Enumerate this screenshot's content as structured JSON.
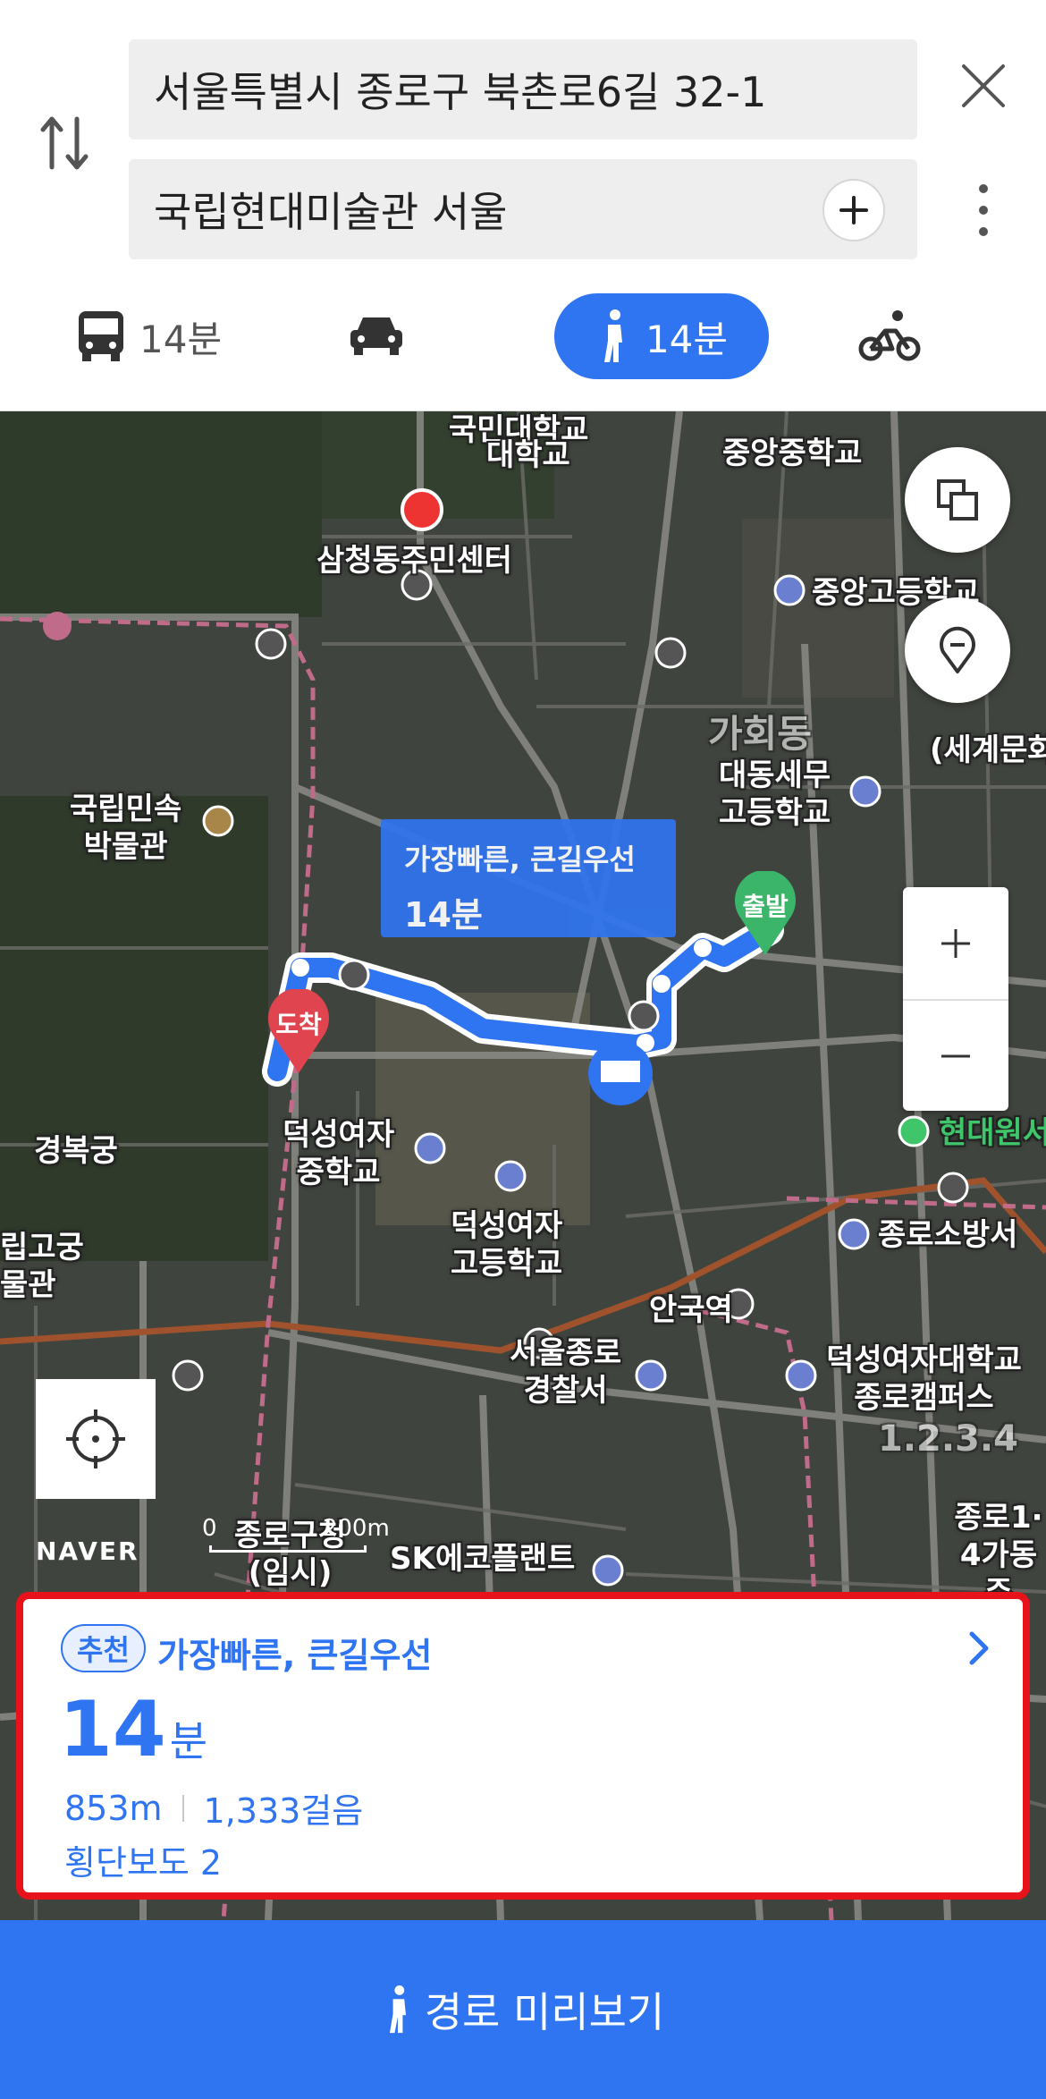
{
  "search": {
    "origin": "서울특별시 종로구 북촌로6길 32-1",
    "destination": "국립현대미술관 서울"
  },
  "modes": [
    {
      "name": "transit",
      "label": "14분"
    },
    {
      "name": "car",
      "label": ""
    },
    {
      "name": "walk",
      "label": "14분",
      "selected": true
    },
    {
      "name": "bike",
      "label": ""
    }
  ],
  "map": {
    "labels": {
      "univ": "대학교",
      "univ_top": "국민대학교",
      "jungang_middle": "중앙중학교",
      "samcheong": "삼청동주민센터",
      "jungang_high": "중앙고등학교",
      "daedong": "대동세무\n고등학교",
      "sekye": "(세계문화",
      "gahoe": "가회동",
      "folk_museum": "국립민속\n박물관",
      "gyeongbok": "경복궁",
      "duksung_middle": "덕성여자\n중학교",
      "duksung_high": "덕성여자\n고등학교",
      "hyundai": "현대원서",
      "fire_station": "종로소방서",
      "anguk": "안국역",
      "police": "서울종로\n경찰서",
      "duksung_univ": "덕성여자대학교\n종로캠퍼스",
      "palace_left": "립고궁\n물관",
      "jongno_gu": "종로구청\n(임시)",
      "sk": "SK에코플랜트",
      "jongno14": "종로1·\n4가동 주",
      "dong_num": "1.2.3.4"
    },
    "route_tooltip": {
      "title": "가장빠른, 큰길우선",
      "time": "14분"
    },
    "start_label": "출발",
    "end_label": "도착",
    "brand": "NAVER",
    "scale_zero": "0",
    "scale_label": "200m",
    "colors": {
      "route": "#2f74f0",
      "start": "#3bb56a",
      "end": "#e0454f"
    }
  },
  "route_card": {
    "badge": "추천",
    "title": "가장빠른, 큰길우선",
    "time_num": "14",
    "time_unit": "분",
    "distance": "853m",
    "steps": "1,333걸음",
    "crosswalks": "횡단보도 2"
  },
  "preview_button": {
    "label": "경로 미리보기"
  }
}
